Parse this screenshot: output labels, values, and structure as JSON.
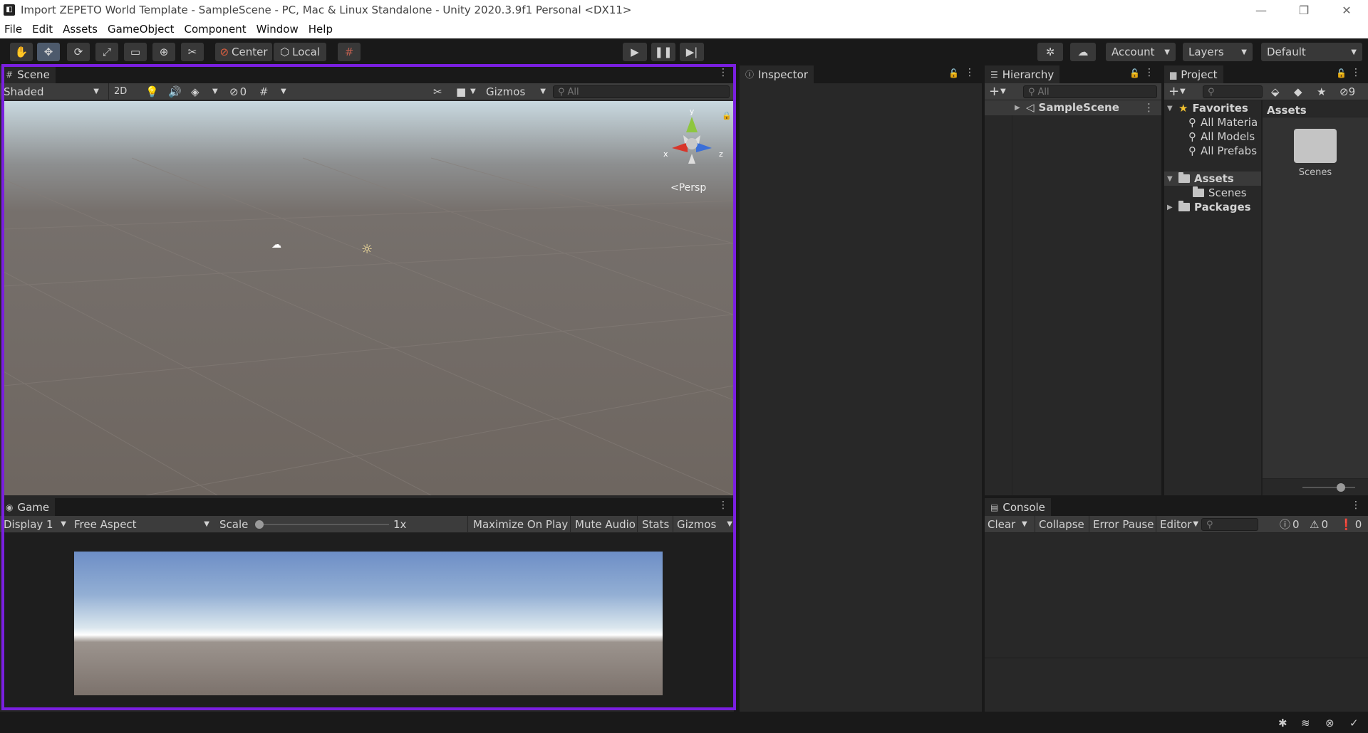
{
  "window": {
    "title": "Import ZEPETO World Template - SampleScene - PC, Mac & Linux Standalone - Unity 2020.3.9f1 Personal <DX11>",
    "controls": [
      "—",
      "❐",
      "✕"
    ]
  },
  "menu": [
    "File",
    "Edit",
    "Assets",
    "GameObject",
    "Component",
    "Window",
    "Help"
  ],
  "toolbar": {
    "pivot_label": "Center",
    "space_label": "Local",
    "account_label": "Account",
    "layers_label": "Layers",
    "layout_label": "Default"
  },
  "scene": {
    "tab_label": "Scene",
    "shading_mode": "Shaded",
    "mode_2d": "2D",
    "hidden_count": "0",
    "gizmos_label": "Gizmos",
    "search_placeholder": "All",
    "projection_label": "Persp",
    "axis_labels": {
      "x": "x",
      "y": "y",
      "z": "z"
    }
  },
  "game": {
    "tab_label": "Game",
    "display": "Display 1",
    "aspect": "Free Aspect",
    "scale_label": "Scale",
    "scale_value": "1x",
    "maximize_label": "Maximize On Play",
    "mute_label": "Mute Audio",
    "stats_label": "Stats",
    "gizmos_label": "Gizmos"
  },
  "inspector": {
    "tab_label": "Inspector"
  },
  "hierarchy": {
    "tab_label": "Hierarchy",
    "search_placeholder": "All",
    "scene_item": "SampleScene"
  },
  "project": {
    "tab_label": "Project",
    "hidden_count": "9",
    "favorites_label": "Favorites",
    "favorites": [
      "All Materia",
      "All Models",
      "All Prefabs"
    ],
    "assets_label": "Assets",
    "assets_children": [
      "Scenes"
    ],
    "packages_label": "Packages",
    "breadcrumb": "Assets",
    "grid_items": [
      "Scenes"
    ]
  },
  "console": {
    "tab_label": "Console",
    "clear_label": "Clear",
    "collapse_label": "Collapse",
    "error_pause_label": "Error Pause",
    "editor_label": "Editor",
    "log_count": "0",
    "warning_count": "0",
    "error_count": "0"
  },
  "colors": {
    "highlight_border": "#7a1fe0",
    "panel_bg": "#282828",
    "toolbar_bg": "#191919"
  }
}
